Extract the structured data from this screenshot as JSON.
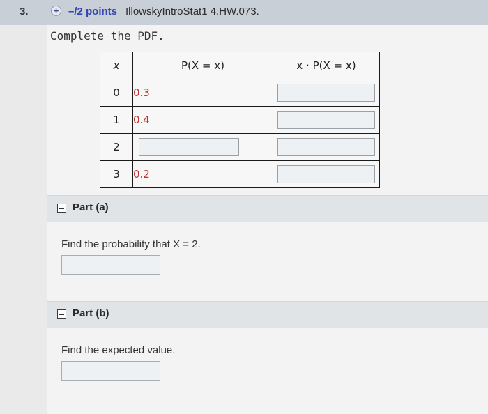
{
  "header": {
    "number": "3.",
    "points": "–/2 points",
    "code": "IllowskyIntroStat1 4.HW.073."
  },
  "instructions": "Complete the PDF.",
  "table": {
    "headers": [
      "x",
      "P(X = x)",
      "x · P(X = x)"
    ],
    "rows": [
      {
        "x": "0",
        "p": "0.3"
      },
      {
        "x": "1",
        "p": "0.4"
      },
      {
        "x": "2",
        "p": ""
      },
      {
        "x": "3",
        "p": "0.2"
      }
    ]
  },
  "parts": [
    {
      "label": "Part (a)",
      "question": "Find the probability that X = 2."
    },
    {
      "label": "Part (b)",
      "question": "Find the expected value."
    }
  ]
}
